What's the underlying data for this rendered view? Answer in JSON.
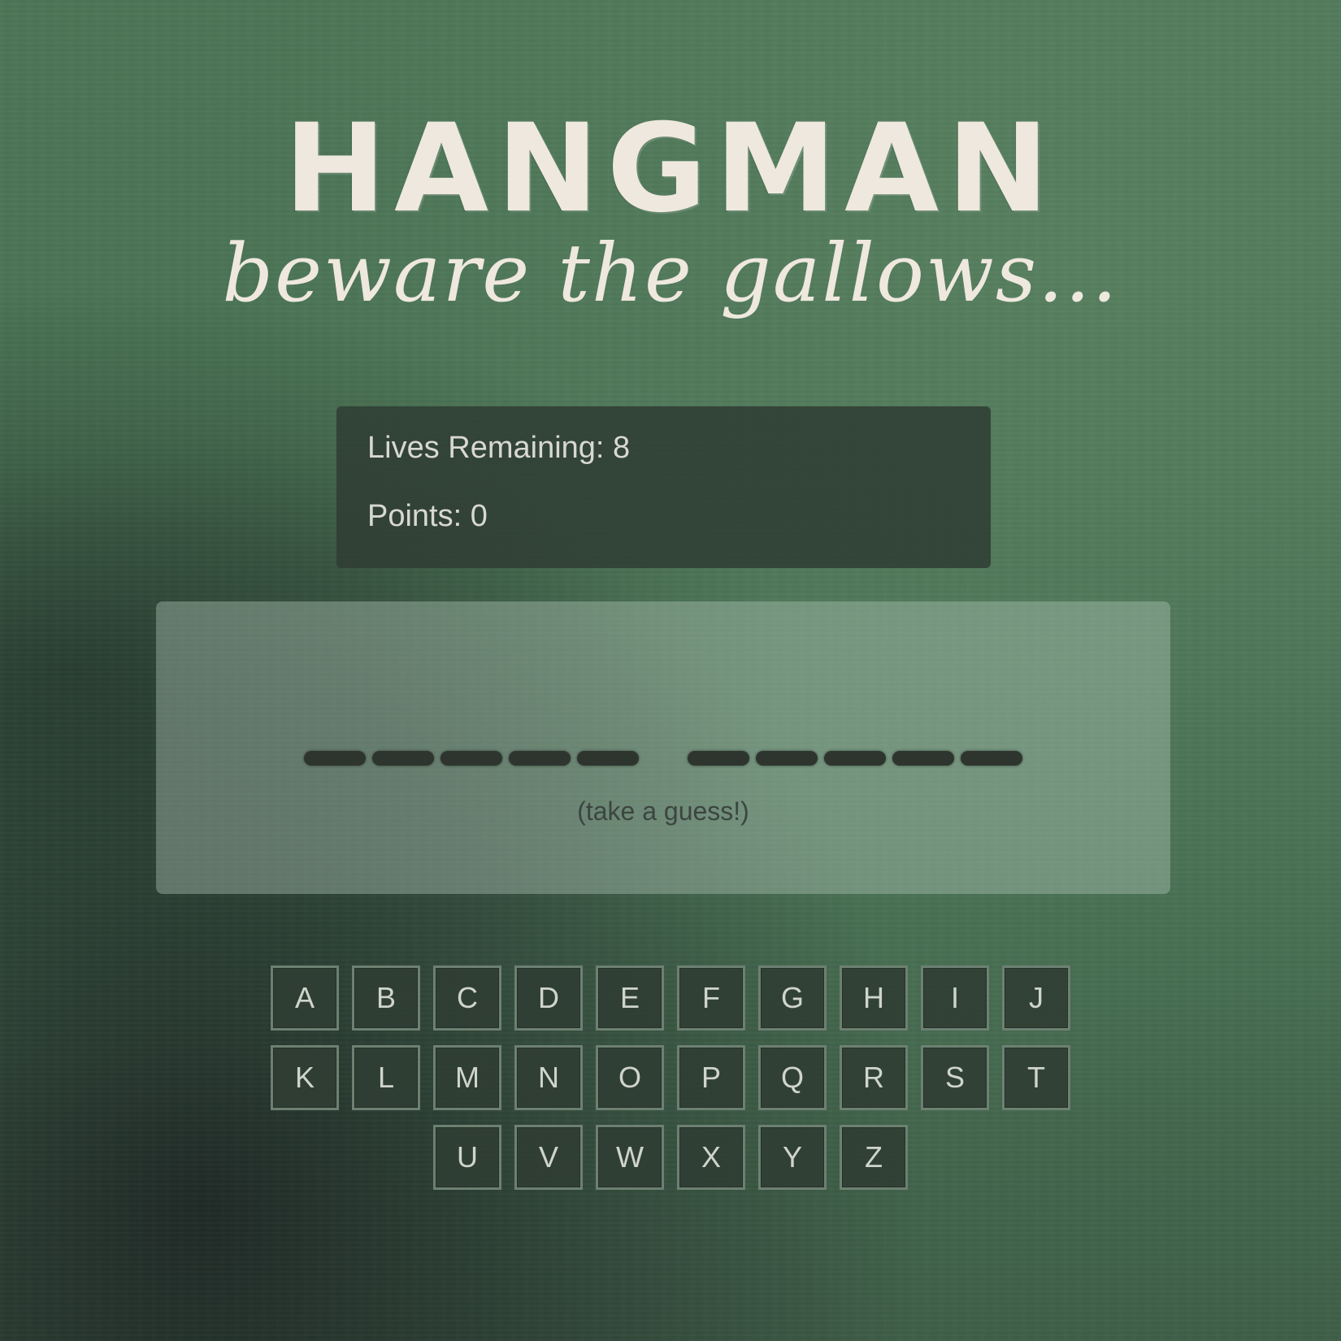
{
  "header": {
    "title": "HANGMAN",
    "subtitle": "beware the gallows..."
  },
  "stats": {
    "lives_label": "Lives Remaining: 8",
    "points_label": "Points: 0"
  },
  "board": {
    "word_slots": [
      [
        "_",
        "_",
        "_",
        "_",
        "_"
      ],
      [
        "_",
        "_",
        "_",
        "_",
        "_"
      ]
    ],
    "hint": "(take a guess!)"
  },
  "keyboard": {
    "rows": [
      [
        "A",
        "B",
        "C",
        "D",
        "E",
        "F",
        "G",
        "H",
        "I",
        "J"
      ],
      [
        "K",
        "L",
        "M",
        "N",
        "O",
        "P",
        "Q",
        "R",
        "S",
        "T"
      ],
      [
        "U",
        "V",
        "W",
        "X",
        "Y",
        "Z"
      ]
    ]
  },
  "colors": {
    "chalkboard": "#4a7254",
    "chalk": "#efe8de",
    "panel": "#303e34",
    "key_border": "#788c7d"
  }
}
